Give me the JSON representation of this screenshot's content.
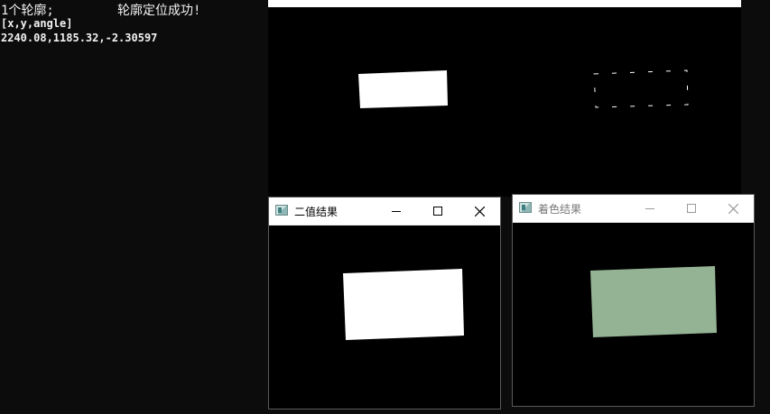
{
  "console": {
    "line1_left": "1个轮廓;",
    "line1_right": "轮廓定位成功!",
    "line2": "[x,y,angle]",
    "line3": "2240.08,1185.32,-2.30597"
  },
  "windows": {
    "binary": {
      "title": "二值结果"
    },
    "colored": {
      "title": "着色结果"
    }
  },
  "icons": {
    "app": "opencv-window-icon",
    "min": "minimize-icon",
    "max": "maximize-icon",
    "close": "close-icon"
  },
  "colors": {
    "console_bg": "#0c0c0c",
    "shape_white": "#ffffff",
    "shape_colored": "#94b394"
  }
}
